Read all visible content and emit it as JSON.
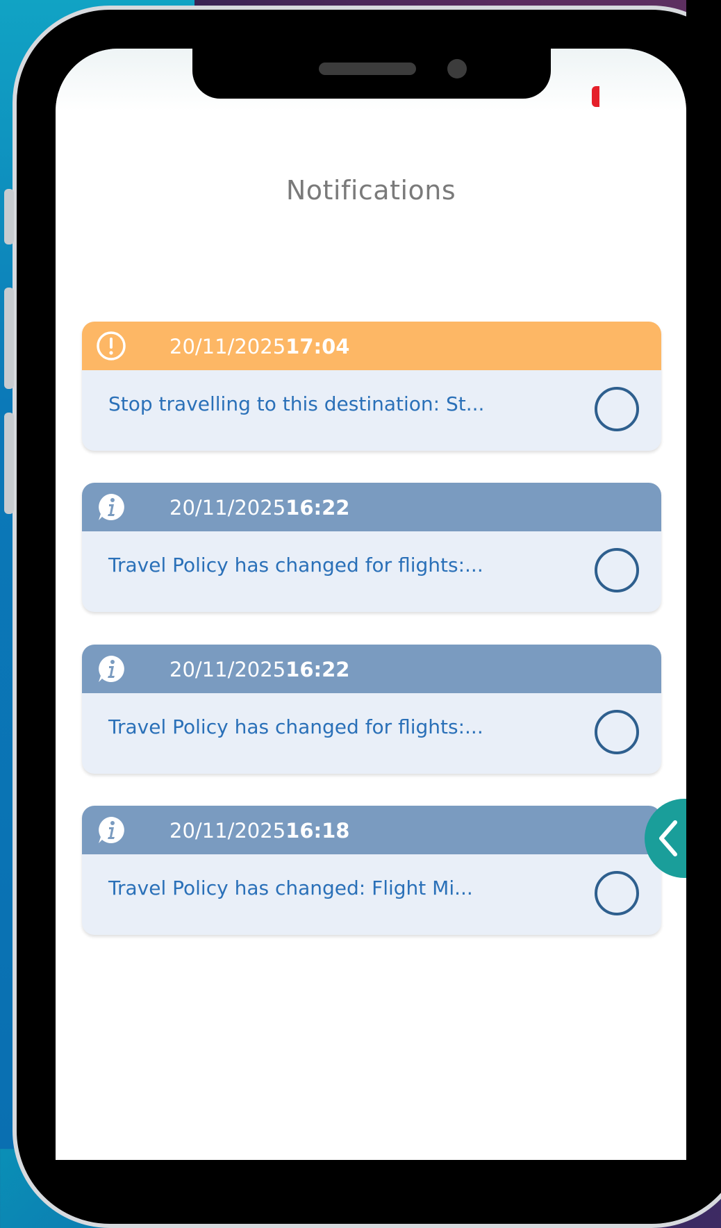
{
  "screen": {
    "title": "Notifications"
  },
  "notifications": [
    {
      "kind": "warning",
      "icon": "exclamation-circle-icon",
      "date": "20/11/2025",
      "time": "17:04",
      "message": "Stop travelling to this destination: St..."
    },
    {
      "kind": "info",
      "icon": "info-bubble-icon",
      "date": "20/11/2025",
      "time": "16:22",
      "message": "Travel Policy has changed for flights:..."
    },
    {
      "kind": "info",
      "icon": "info-bubble-icon",
      "date": "20/11/2025",
      "time": "16:22",
      "message": "Travel Policy has changed for flights:..."
    },
    {
      "kind": "info",
      "icon": "info-bubble-icon",
      "date": "20/11/2025",
      "time": "16:18",
      "message": "Travel Policy has changed: Flight Mi..."
    }
  ],
  "colors": {
    "warning_header": "#fdb765",
    "info_header": "#7a9bc0",
    "card_body": "#e9eff8",
    "message_text": "#2a70b8",
    "radio_ring": "#2e5f8e",
    "side_tab": "#1a9e9a",
    "recording_indicator": "#e5202a"
  },
  "side_tab": {
    "icon": "chevron-left-icon"
  }
}
